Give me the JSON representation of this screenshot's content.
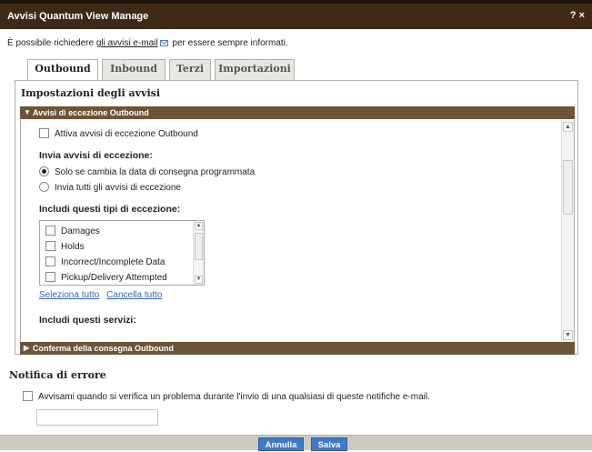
{
  "window": {
    "title": "Avvisi Quantum View Manage",
    "help": "? ×"
  },
  "intro": {
    "before": "È possibile richiedere ",
    "link": "gli avvisi e-mail",
    "after": " per essere sempre informati."
  },
  "tabs": [
    "Outbound",
    "Inbound",
    "Terzi",
    "Importazioni"
  ],
  "panel": {
    "title": "Impostazioni degli avvisi",
    "section_outbound": "Avvisi di eccezione Outbound",
    "enable_outbound": "Attiva avvisi di eccezione Outbound",
    "send_heading": "Invia avvisi di eccezione:",
    "radio_options": [
      "Solo se cambia la data di consegna programmata",
      "Invia tutti gli avvisi di eccezione"
    ],
    "include_types_heading": "Includi questi tipi di eccezione:",
    "exception_types": [
      "Damages",
      "Holds",
      "Incorrect/Incomplete Data",
      "Pickup/Delivery Attempted"
    ],
    "select_all": "Seleziona tutto",
    "clear_all": "Cancella tutto",
    "include_services_heading": "Includi questi servizi:",
    "section_delivery": "Conferma della consegna Outbound"
  },
  "notify": {
    "title": "Notifica di errore",
    "checkbox_label": "Avvisami quando si verifica un problema durante l'invio di una qualsiasi di queste notifiche e-mail.",
    "input_value": ""
  },
  "footer": {
    "cancel": "Annulla",
    "save": "Salva"
  }
}
